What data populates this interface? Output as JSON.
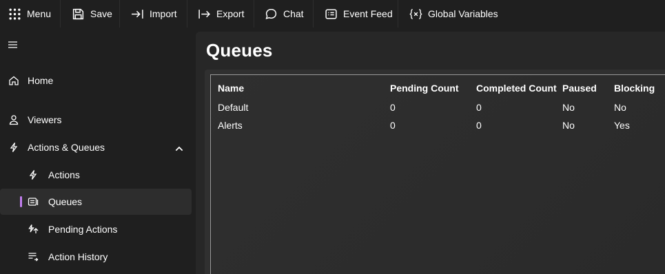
{
  "toolbar": {
    "menu": "Menu",
    "save": "Save",
    "import": "Import",
    "export": "Export",
    "chat": "Chat",
    "event_feed": "Event Feed",
    "global_variables": "Global Variables"
  },
  "sidebar": {
    "items": [
      {
        "label": "Home",
        "icon": "home-icon"
      },
      {
        "label": "Viewers",
        "icon": "person-icon"
      },
      {
        "label": "Actions & Queues",
        "icon": "flash-icon",
        "expanded": true
      },
      {
        "label": "Actions",
        "icon": "flash-icon"
      },
      {
        "label": "Queues",
        "icon": "queue-icon",
        "selected": true
      },
      {
        "label": "Pending Actions",
        "icon": "pending-actions-icon"
      },
      {
        "label": "Action History",
        "icon": "history-list-icon"
      }
    ]
  },
  "page": {
    "title": "Queues"
  },
  "table": {
    "columns": [
      "Name",
      "Pending Count",
      "Completed Count",
      "Paused",
      "Blocking"
    ],
    "rows": [
      [
        "Default",
        "0",
        "0",
        "No",
        "No"
      ],
      [
        "Alerts",
        "0",
        "0",
        "No",
        "Yes"
      ]
    ]
  },
  "colors": {
    "background": "#1f1f1f",
    "content": "#272727",
    "accent": "#c27ff0"
  }
}
